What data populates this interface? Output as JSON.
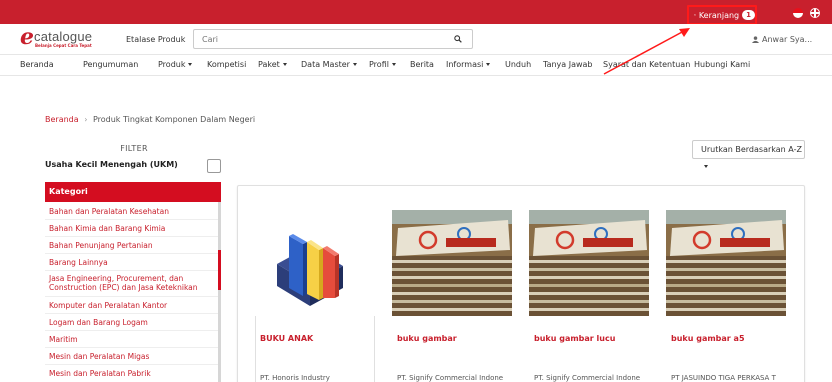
{
  "topbar": {
    "cart_label": "Keranjang",
    "cart_count": "1"
  },
  "header": {
    "logo_text": "catalogue",
    "logo_tagline": "Belanja Cepat Cara Tepat",
    "etalase_label": "Etalase Produk",
    "search_placeholder": "Cari",
    "user_name": "Anwar Sya..."
  },
  "nav": {
    "items": [
      {
        "label": "Beranda"
      },
      {
        "label": "Pengumuman"
      },
      {
        "label": "Produk"
      },
      {
        "label": "Kompetisi"
      },
      {
        "label": "Paket"
      },
      {
        "label": "Data Master"
      },
      {
        "label": "Profil"
      },
      {
        "label": "Berita"
      },
      {
        "label": "Informasi"
      },
      {
        "label": "Unduh"
      },
      {
        "label": "Tanya Jawab"
      },
      {
        "label": "Syarat dan Ketentuan"
      },
      {
        "label": "Hubungi Kami"
      }
    ]
  },
  "breadcrumb": {
    "home": "Beranda",
    "separator": "›",
    "current": "Produk Tingkat Komponen Dalam Negeri"
  },
  "filter": {
    "title": "FILTER",
    "ukm_label": "Usaha Kecil Menengah (UKM)",
    "ukm_checked": false,
    "kategori_title": "Kategori",
    "categories": [
      "Bahan dan Peralatan Kesehatan",
      "Bahan Kimia dan Barang Kimia",
      "Bahan Penunjang Pertanian",
      "Barang Lainnya",
      "Jasa Engineering, Procurement, dan Construction (EPC) dan Jasa Keteknikan",
      "Komputer dan Peralatan Kantor",
      "Logam dan Barang Logam",
      "Maritim",
      "Mesin dan Peralatan Migas",
      "Mesin dan Peralatan Pabrik"
    ]
  },
  "sort": {
    "label": "Urutkan Berdasarkan A-Z"
  },
  "products": [
    {
      "name": "BUKU ANAK",
      "seller": "PT. Honoris Industry"
    },
    {
      "name": "buku gambar",
      "seller": "PT. Signify Commercial Indone"
    },
    {
      "name": "buku gambar lucu",
      "seller": "PT. Signify Commercial Indone"
    },
    {
      "name": "buku gambar a5",
      "seller": "PT JASUINDO TIGA PERKASA T"
    }
  ],
  "colors": {
    "brand_red": "#c8202d",
    "kategori_red": "#d40d20",
    "annotation_red": "#ff1a1a"
  }
}
